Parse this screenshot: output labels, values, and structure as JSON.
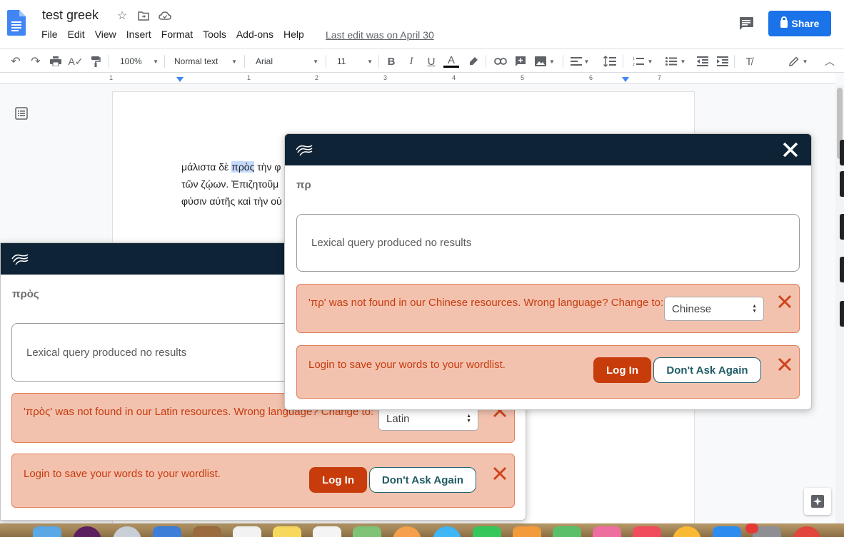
{
  "doc": {
    "title": "test greek",
    "menu": [
      "File",
      "Edit",
      "View",
      "Insert",
      "Format",
      "Tools",
      "Add-ons",
      "Help"
    ],
    "last_edit": "Last edit was on April 30",
    "share_label": "Share"
  },
  "toolbar": {
    "zoom": "100%",
    "style": "Normal text",
    "font": "Arial",
    "size": "11"
  },
  "ruler": {
    "numbers": [
      "1",
      "1",
      "2",
      "3",
      "4",
      "5",
      "6",
      "7"
    ]
  },
  "document_text": {
    "line1_before": "μάλιστα δὲ ",
    "line1_highlight": "πρὸς",
    "line1_after": " τὴν φ",
    "line2": "τῶν ζῴων. Ἐπιζητοῦμ",
    "line3": "φύσιν αὐτῆς καὶ τὴν οὐ"
  },
  "popup_front": {
    "word": "πρ",
    "results": "Lexical query produced no results",
    "language_alert": "'πρ' was not found in our Chinese resources. Wrong language? Change to:",
    "language_selected": "Chinese",
    "login_alert": "Login to save your words to your wordlist.",
    "login_label": "Log In",
    "dont_ask_label": "Don't Ask Again"
  },
  "popup_back": {
    "word": "πρὸς",
    "results": "Lexical query produced no results",
    "language_alert": "'πρὸς' was not found in our Latin resources. Wrong language? Change to:",
    "language_selected": "Latin",
    "login_alert": "Login to save your words to your wordlist.",
    "login_label": "Log In",
    "dont_ask_label": "Don't Ask Again"
  },
  "colors": {
    "header_navy": "#0f2336",
    "alert_bg": "#f3c2ae",
    "alert_text": "#c63b0f",
    "login_btn": "#c83c0b",
    "share_blue": "#1a73e8"
  }
}
